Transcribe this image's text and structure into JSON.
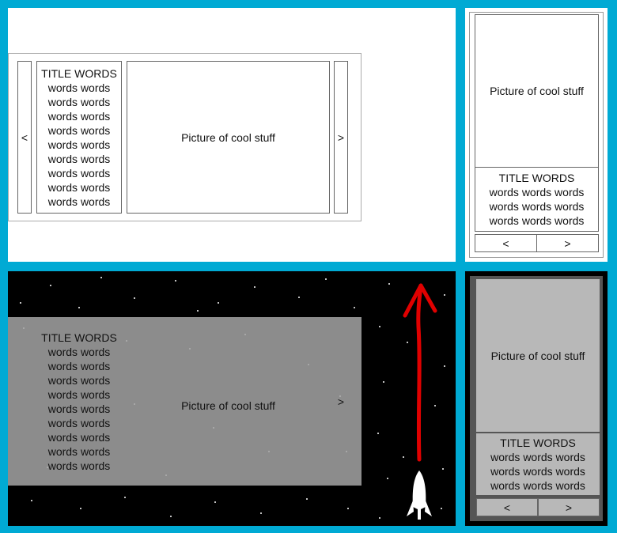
{
  "carousel": {
    "title": "TITLE WORDS",
    "body_line_wide": "words words",
    "body_line_narrow": "words words words",
    "picture": "Picture of cool stuff",
    "prev": "<",
    "next": ">"
  },
  "colors": {
    "border": "#00aad4",
    "gray_panel": "#8c8c8c",
    "light_gray": "#b8b8b8",
    "dark_frame": "#555555",
    "red_arrow": "#e00000"
  },
  "icons": [
    "rocket-icon",
    "red-up-arrow-icon"
  ]
}
